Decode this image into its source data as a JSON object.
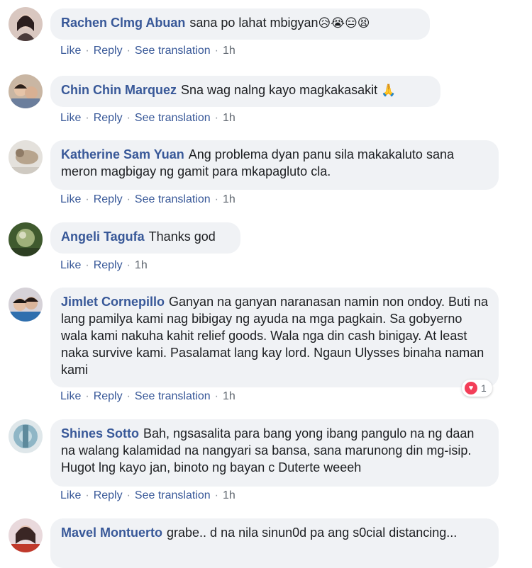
{
  "comments": [
    {
      "name": "Rachen Clmg Abuan",
      "text": "sana po lahat mbigyan",
      "emoji": "😥😭😑😫",
      "actions": [
        "Like",
        "Reply",
        "See translation"
      ],
      "time": "1h"
    },
    {
      "name": "Chin Chin Marquez",
      "text": "Sna wag nalng kayo magkakasakit",
      "emoji": "🙏",
      "actions": [
        "Like",
        "Reply",
        "See translation"
      ],
      "time": "1h"
    },
    {
      "name": "Katherine Sam Yuan",
      "text": "Ang problema dyan panu sila makakaluto sana meron magbigay ng gamit para mkapagluto cla.",
      "actions": [
        "Like",
        "Reply",
        "See translation"
      ],
      "time": "1h"
    },
    {
      "name": "Angeli Tagufa",
      "text": "Thanks god",
      "actions": [
        "Like",
        "Reply"
      ],
      "time": "1h"
    },
    {
      "name": "Jimlet Cornepillo",
      "text": "Ganyan na ganyan naranasan namin non ondoy. Buti na lang pamilya kami nag bibigay ng ayuda na mga pagkain. Sa gobyerno wala kami nakuha kahit relief goods. Wala nga din cash binigay. At least naka survive kami. Pasalamat lang kay lord. Ngaun Ulysses binaha naman kami",
      "actions": [
        "Like",
        "Reply",
        "See translation"
      ],
      "time": "1h",
      "reaction_count": "1"
    },
    {
      "name": "Shines Sotto",
      "text": "Bah, ngsasalita para bang yong ibang pangulo na ng daan na walang kalamidad na nangyari sa bansa, sana marunong din mg-isip. Hugot lng kayo jan, binoto ng bayan c Duterte weeeh",
      "actions": [
        "Like",
        "Reply",
        "See translation"
      ],
      "time": "1h"
    },
    {
      "name": "Mavel Montuerto",
      "text": "grabe.. d na nila sinun0d pa ang s0cial distancing...",
      "actions": []
    }
  ],
  "colors": {
    "name": "#385898",
    "bubble": "#f0f2f5",
    "text": "#1c1e21",
    "reaction": "#f33e58"
  },
  "icons": {
    "reaction": "heart-icon"
  }
}
